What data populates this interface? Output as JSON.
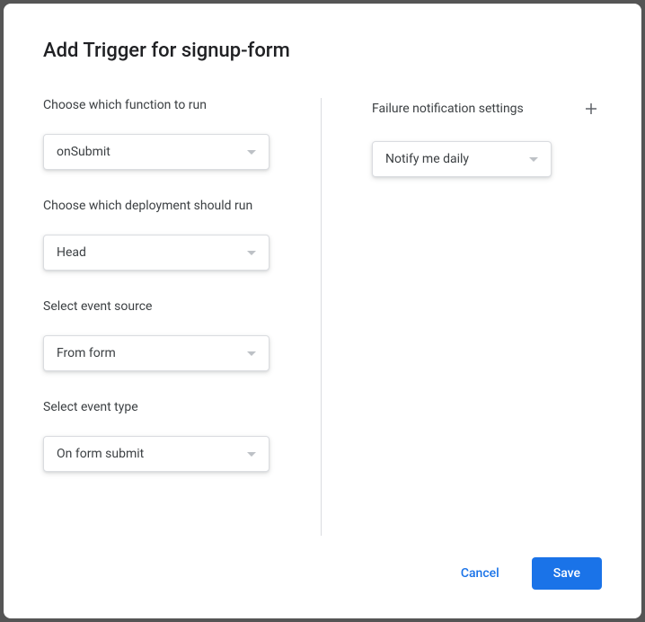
{
  "title": "Add Trigger for signup-form",
  "left": {
    "function": {
      "label": "Choose which function to run",
      "value": "onSubmit"
    },
    "deployment": {
      "label": "Choose which deployment should run",
      "value": "Head"
    },
    "source": {
      "label": "Select event source",
      "value": "From form"
    },
    "eventType": {
      "label": "Select event type",
      "value": "On form submit"
    }
  },
  "right": {
    "notifications": {
      "label": "Failure notification settings",
      "value": "Notify me daily"
    }
  },
  "footer": {
    "cancel": "Cancel",
    "save": "Save"
  }
}
